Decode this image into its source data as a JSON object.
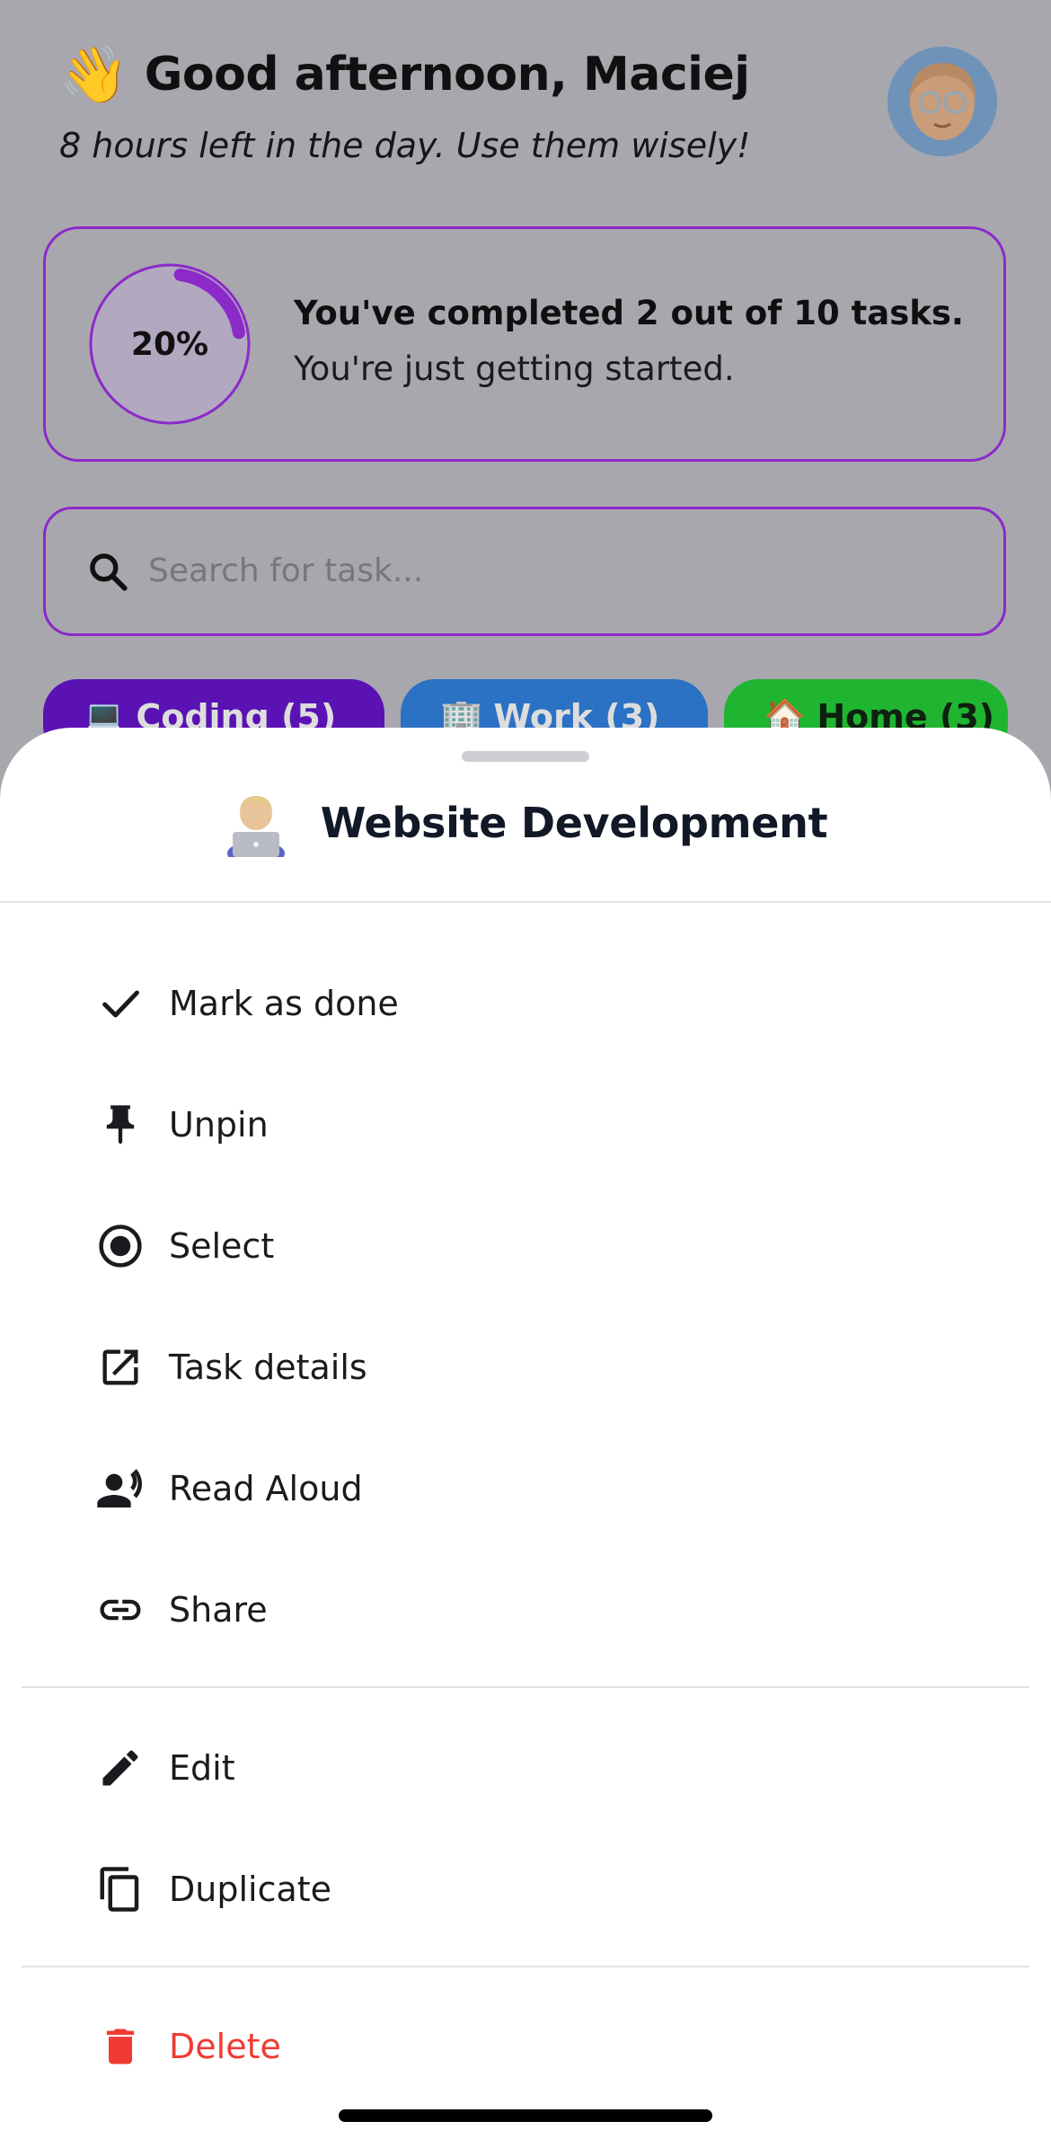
{
  "header": {
    "greeting_emoji": "👋",
    "greeting": "Good afternoon, Maciej",
    "subtitle": "8 hours left in the day. Use them wisely!"
  },
  "progress": {
    "percent_label": "20%",
    "fraction": 0.2,
    "title": "You've completed 2 out of 10 tasks.",
    "subtitle": "You're just getting started."
  },
  "search": {
    "placeholder": "Search for task..."
  },
  "categories": [
    {
      "emoji": "💻",
      "label": "Coding (5)",
      "color": "#5a12b4"
    },
    {
      "emoji": "🏢",
      "label": "Work (3)",
      "color": "#2b71c4"
    },
    {
      "emoji": "🏠",
      "label": "Home (3)",
      "color": "#1fb531"
    }
  ],
  "sheet": {
    "title": "Website Development",
    "title_emoji": "technologist-emoji",
    "items": [
      {
        "label": "Mark as done",
        "icon": "check-icon"
      },
      {
        "label": "Unpin",
        "icon": "pin-icon"
      },
      {
        "label": "Select",
        "icon": "radio-selected-icon"
      },
      {
        "label": "Task details",
        "icon": "open-in-new-icon"
      },
      {
        "label": "Read Aloud",
        "icon": "record-voice-icon"
      },
      {
        "label": "Share",
        "icon": "link-icon"
      },
      {
        "label": "Edit",
        "icon": "pencil-icon"
      },
      {
        "label": "Duplicate",
        "icon": "copy-icon"
      },
      {
        "label": "Delete",
        "icon": "trash-icon"
      }
    ]
  },
  "colors": {
    "accent": "#8b2ac9",
    "danger": "#f03a34",
    "text": "#1a1a1f"
  }
}
